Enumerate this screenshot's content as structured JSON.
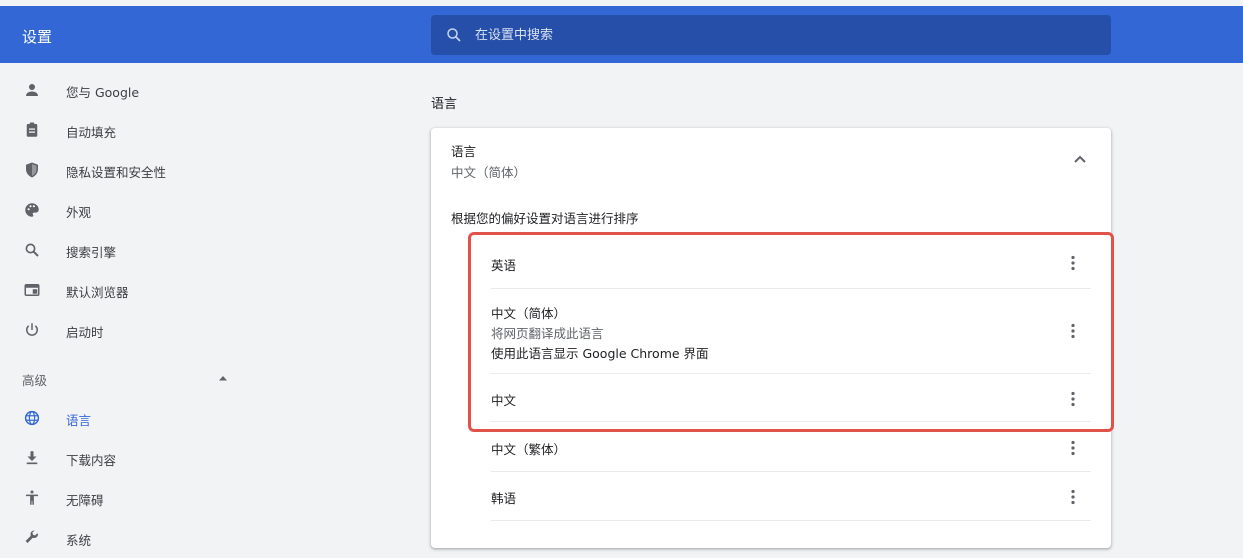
{
  "app": {
    "title": "设置"
  },
  "search": {
    "placeholder": "在设置中搜索",
    "icon": "search-icon"
  },
  "sidebar": {
    "items": [
      {
        "label": "您与 Google",
        "icon": "person-icon"
      },
      {
        "label": "自动填充",
        "icon": "clipboard-icon"
      },
      {
        "label": "隐私设置和安全性",
        "icon": "shield-icon"
      },
      {
        "label": "外观",
        "icon": "palette-icon"
      },
      {
        "label": "搜索引擎",
        "icon": "search-icon"
      },
      {
        "label": "默认浏览器",
        "icon": "browser-icon"
      },
      {
        "label": "启动时",
        "icon": "power-icon"
      }
    ],
    "advanced_label": "高级",
    "advanced_items": [
      {
        "label": "语言",
        "icon": "globe-icon",
        "active": true
      },
      {
        "label": "下载内容",
        "icon": "download-icon"
      },
      {
        "label": "无障碍",
        "icon": "accessibility-icon"
      },
      {
        "label": "系统",
        "icon": "wrench-icon"
      }
    ]
  },
  "main": {
    "section_title": "语言",
    "card": {
      "title": "语言",
      "subtitle": "中文（简体）",
      "order_description": "根据您的偏好设置对语言进行排序",
      "languages": [
        {
          "name": "英语"
        },
        {
          "name": "中文（简体）",
          "note1": "将网页翻译成此语言",
          "note2": "使用此语言显示 Google Chrome 界面"
        },
        {
          "name": "中文"
        },
        {
          "name": "中文（繁体）"
        },
        {
          "name": "韩语"
        }
      ]
    }
  },
  "colors": {
    "header": "#3367d6",
    "search_bg": "#254fa8",
    "accent": "#3367d6",
    "highlight": "#e0524a"
  }
}
